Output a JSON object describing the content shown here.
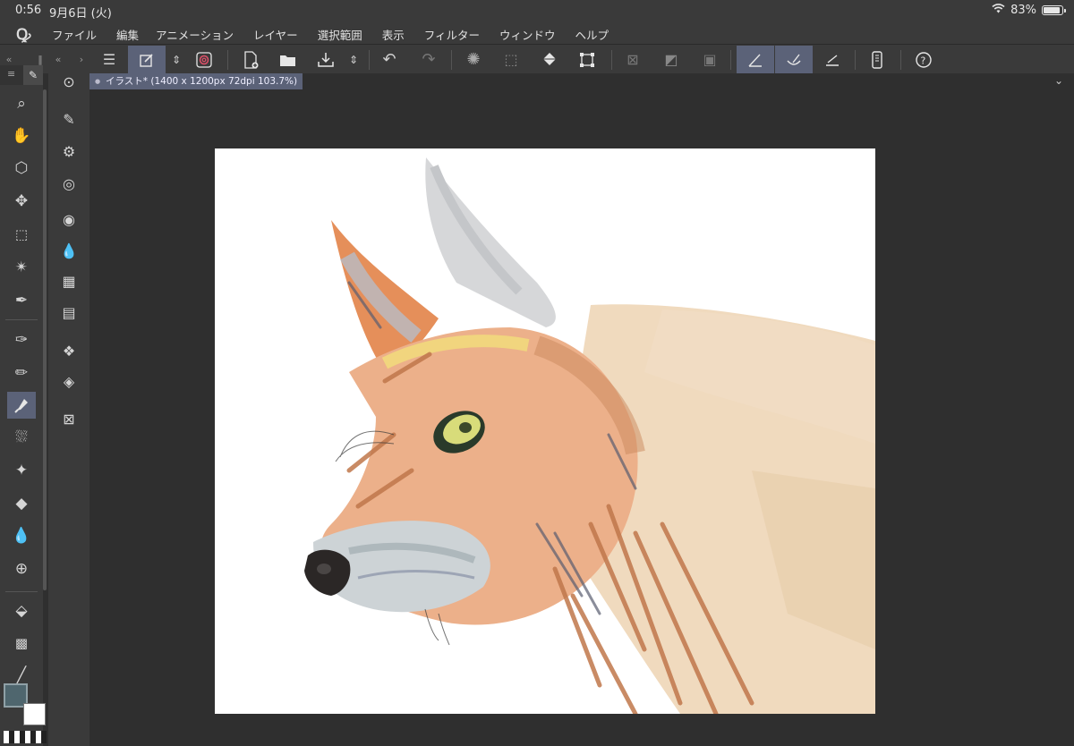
{
  "status": {
    "time": "0:56",
    "date": "9月6日 (火)",
    "battery": "83%",
    "battery_level": 0.83
  },
  "menubar": {
    "items": [
      "ファイル",
      "編集",
      "アニメーション",
      "レイヤー",
      "選択範囲",
      "表示",
      "フィルター",
      "ウィンドウ",
      "ヘルプ"
    ]
  },
  "toolbar": {
    "icons": [
      "menu-icon",
      "new-canvas-icon",
      "spiral-icon",
      "new-file-icon",
      "open-file-icon",
      "save-icon",
      "undo-icon",
      "redo-icon",
      "loading-icon",
      "select-all-icon",
      "fill-icon",
      "transform-icon",
      "clear-icon",
      "tone-icon",
      "hide-selection-icon",
      "snap-ruler-icon",
      "snap-special-ruler-icon",
      "grid-snap-icon",
      "smartphone-icon",
      "help-icon"
    ]
  },
  "document": {
    "tab_label": "イラスト* (1400 x 1200px 72dpi 103.7%)"
  },
  "toolbox": {
    "tools": [
      "zoom-icon",
      "hand-icon",
      "operation-icon",
      "move-icon",
      "selection-icon",
      "magic-wand-icon",
      "eyedropper-icon",
      "pen-icon",
      "pencil-icon",
      "brush-icon",
      "airbrush-icon",
      "decoration-icon",
      "eraser-icon",
      "blend-icon",
      "figure-icon",
      "fill-bucket-icon",
      "gradient-icon",
      "line-icon"
    ],
    "selected": "brush-icon",
    "main_color": "#4f666e",
    "sub_color": "#ffffff"
  },
  "subtools": {
    "icons": [
      "navigator-icon",
      "brush-settings-icon",
      "brush-gear-icon",
      "brush-target-icon",
      "circle-icon",
      "water-icon",
      "grid-material-icon",
      "filmstrip-icon",
      "layer-props-icon",
      "layers-icon",
      "close-panel-icon"
    ]
  },
  "colors": {
    "selected": "#5b6278",
    "panel": "#3a3a3a",
    "workspace": "#2f2f2f"
  }
}
